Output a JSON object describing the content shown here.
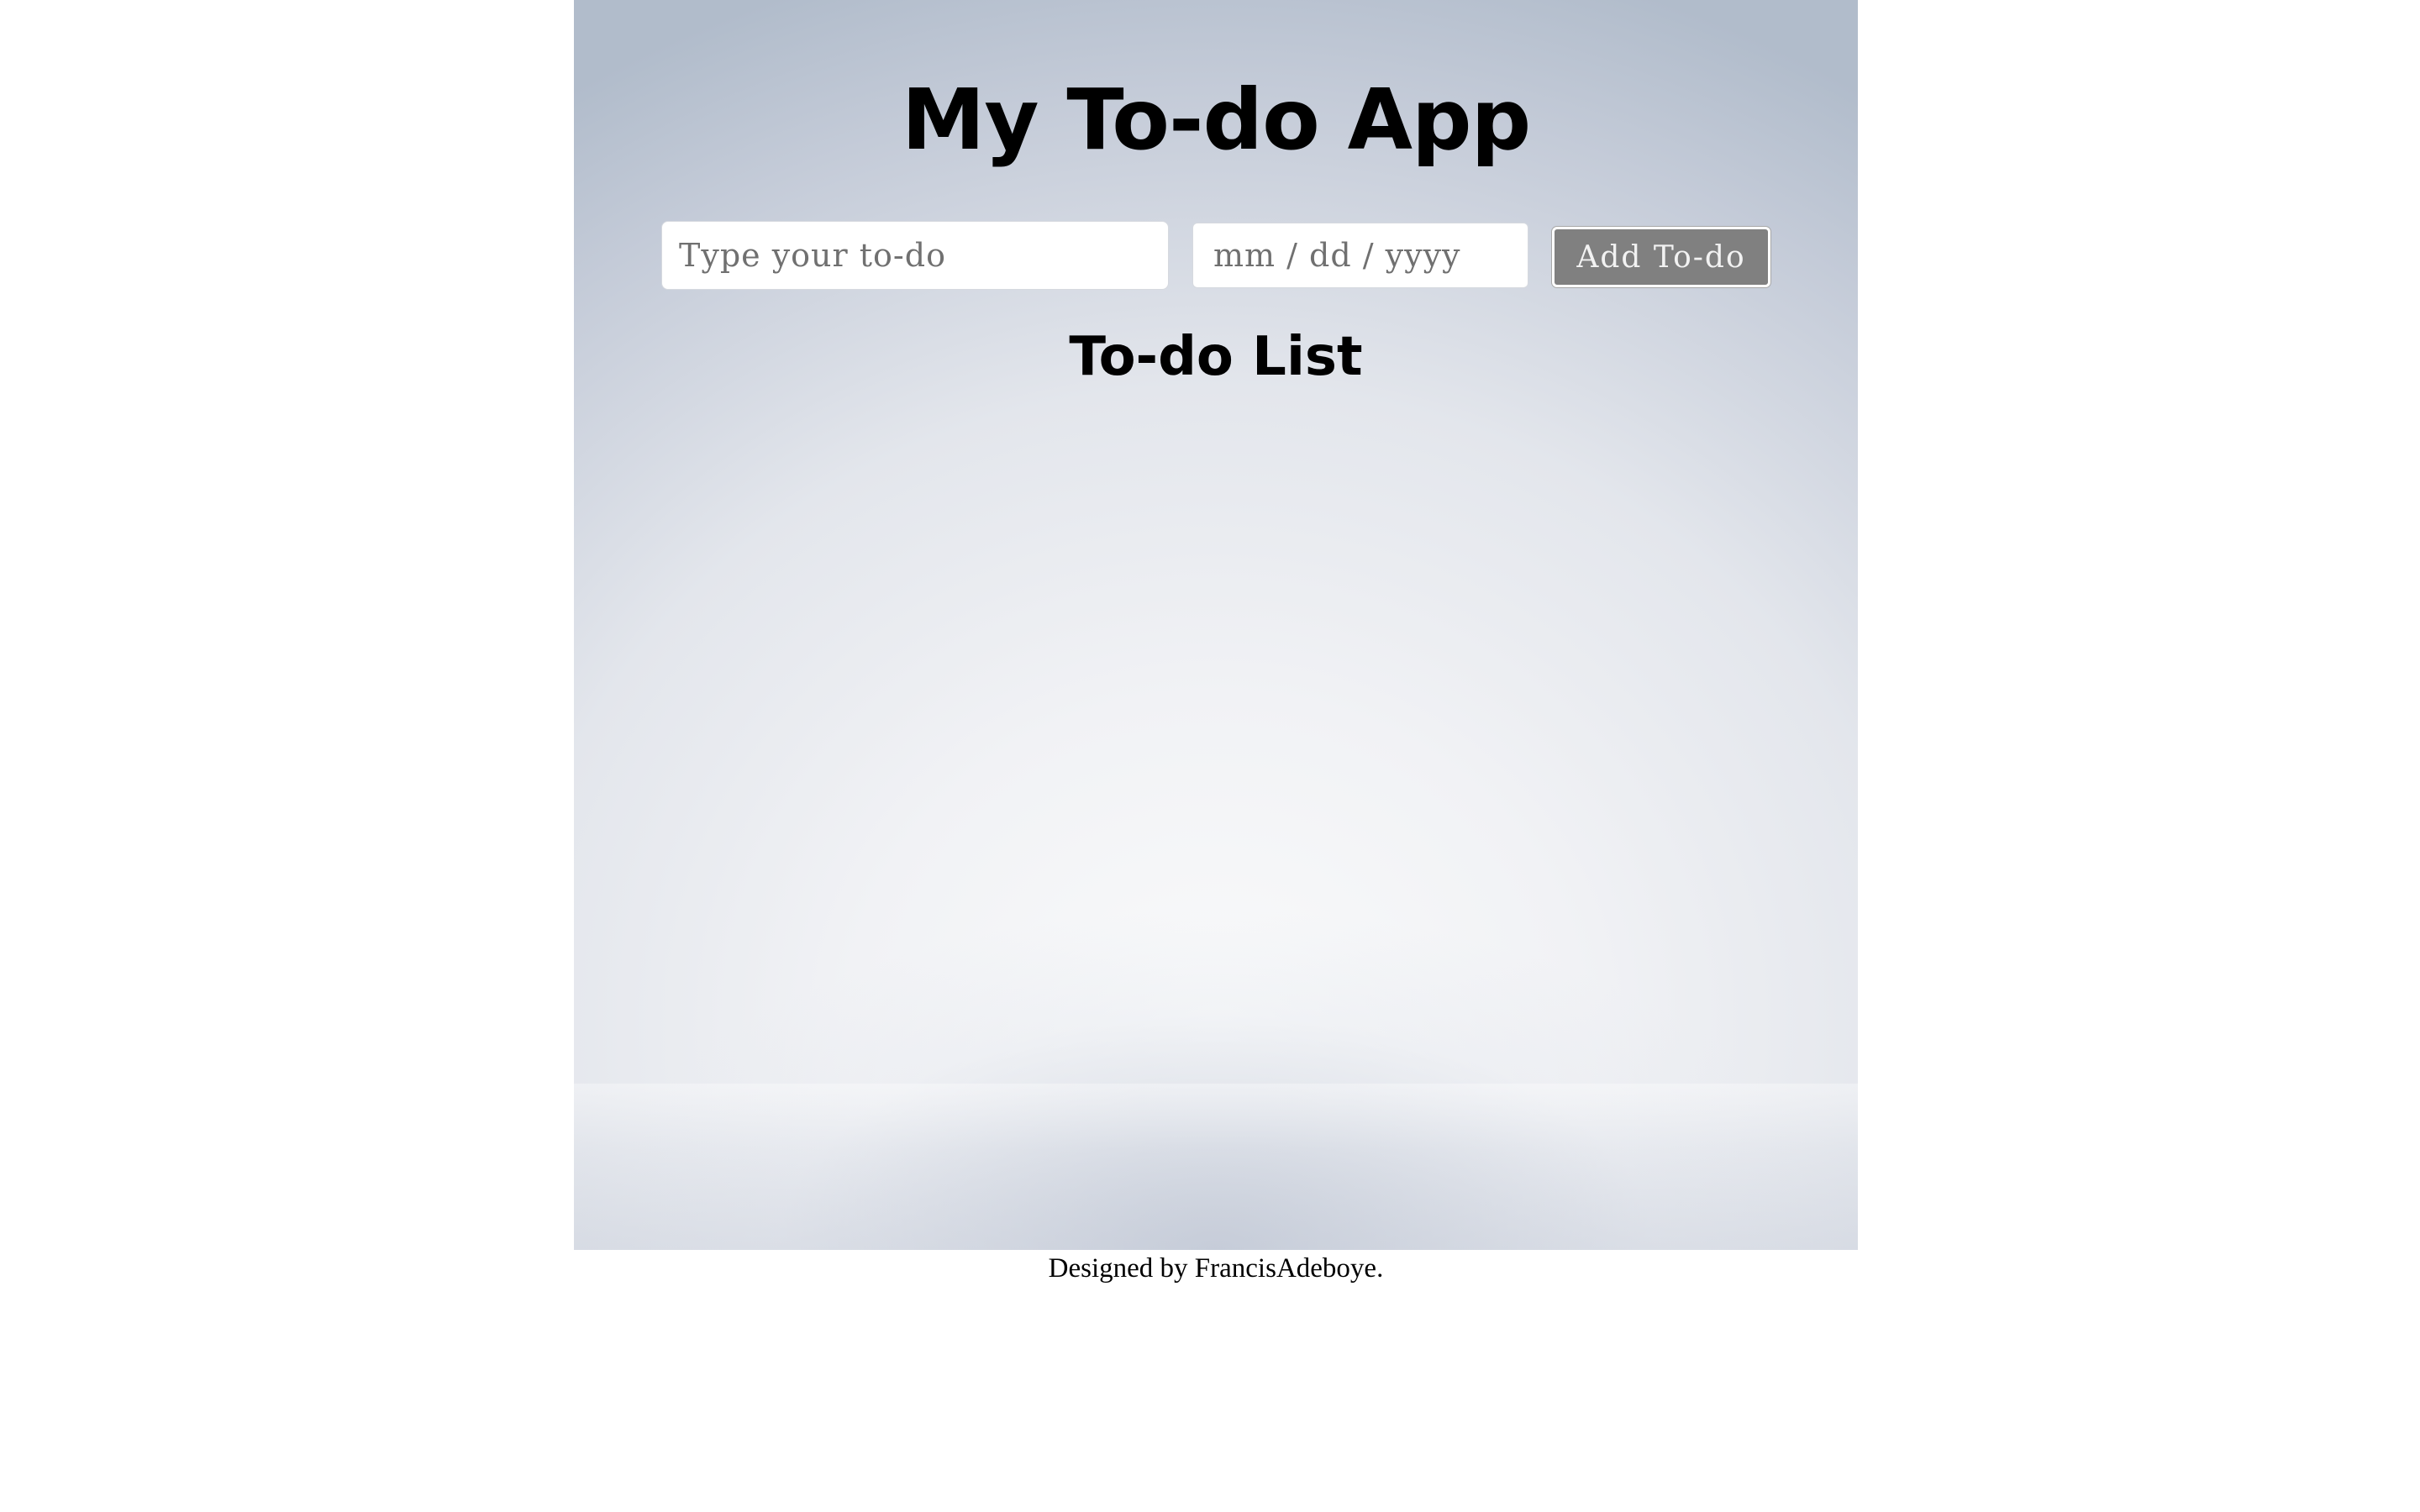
{
  "header": {
    "title": "My To-do App"
  },
  "form": {
    "todo_placeholder": "Type your to-do",
    "todo_value": "",
    "date_placeholder": "mm / dd / yyyy",
    "date_value": "",
    "add_button_label": "Add To-do"
  },
  "list": {
    "heading": "To-do List",
    "items": []
  },
  "footer": {
    "text": "Designed by FrancisAdeboye."
  },
  "colors": {
    "button_background": "#808080",
    "button_text": "#f2f2f2",
    "input_background": "#ffffff",
    "page_background": "#ffffff"
  }
}
